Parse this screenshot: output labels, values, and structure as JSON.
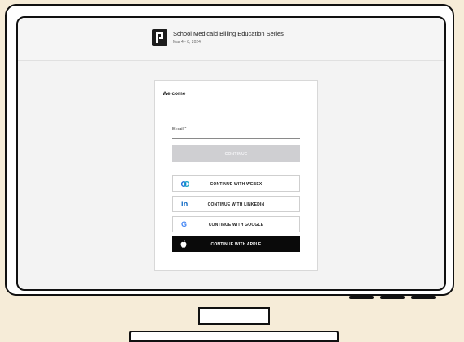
{
  "event": {
    "title": "School Medicaid Billing Education Series",
    "date": "Mar 4 - 8, 2024"
  },
  "login": {
    "heading": "Welcome",
    "email_label": "Email *",
    "email_value": "",
    "continue_label": "CONTINUE",
    "webex_label": "CONTINUE WITH WEBEX",
    "linkedin_label": "CONTINUE WITH LINKEDIN",
    "linkedin_icon_text": "in",
    "google_label": "CONTINUE WITH GOOGLE",
    "google_icon_text": "G",
    "apple_label": "CONTINUE WITH APPLE"
  },
  "icons": {
    "logo": "brand-logo-icon",
    "webex": "webex-icon",
    "linkedin": "linkedin-icon",
    "google": "google-icon",
    "apple": "apple-icon"
  },
  "colors": {
    "background": "#f6ecd8",
    "continue_disabled": "#cfcfd2",
    "apple_button": "#0a0a0a",
    "linkedin_blue": "#0a66c2",
    "google_blue": "#4285f4",
    "webex_blue": "#1e6fd9"
  }
}
